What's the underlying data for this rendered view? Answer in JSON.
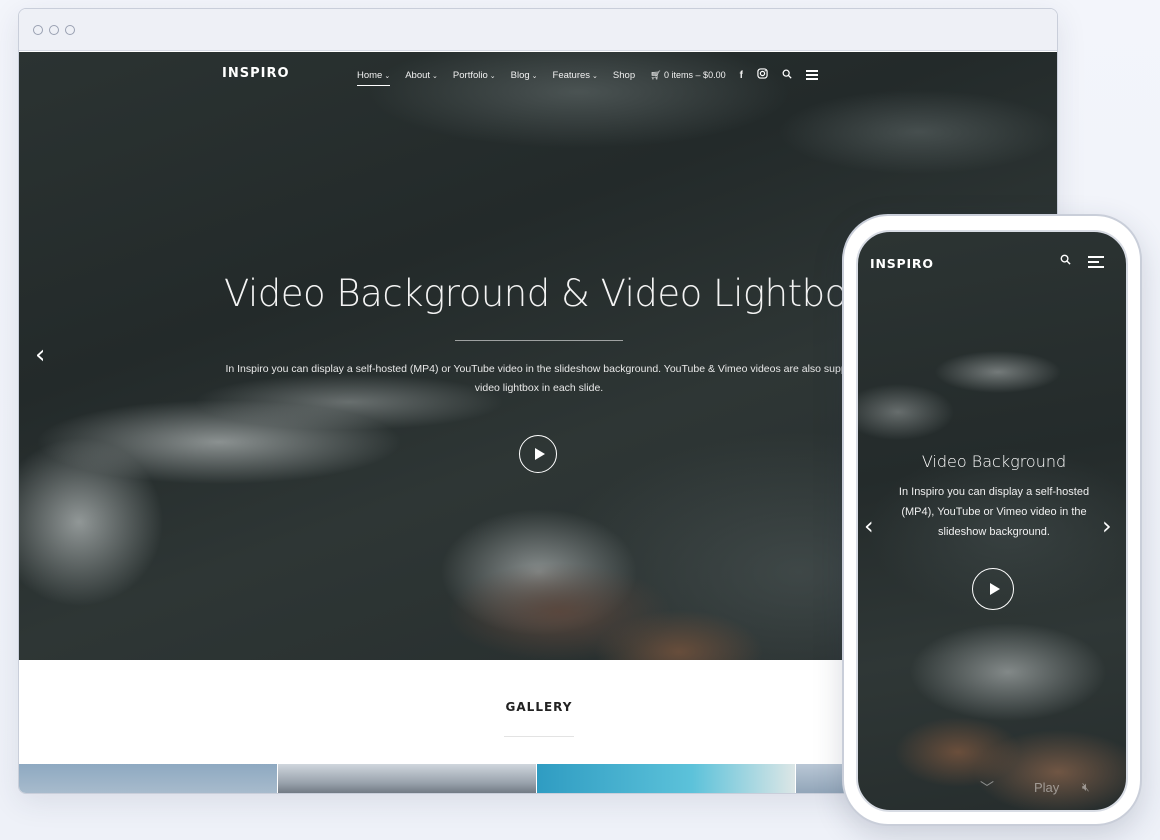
{
  "desktop": {
    "brand": "INSPIRO",
    "menu": [
      {
        "label": "Home",
        "has_dropdown": true,
        "active": true
      },
      {
        "label": "About",
        "has_dropdown": true
      },
      {
        "label": "Portfolio",
        "has_dropdown": true
      },
      {
        "label": "Blog",
        "has_dropdown": true
      },
      {
        "label": "Features",
        "has_dropdown": true
      },
      {
        "label": "Shop",
        "has_dropdown": false
      }
    ],
    "cart_label": "0 items – $0.00",
    "icons": {
      "cart": "cart-icon",
      "facebook": "facebook-icon",
      "instagram": "instagram-icon",
      "search": "search-icon",
      "menu": "hamburger-menu-icon",
      "prev": "chevron-left-icon",
      "play": "play-icon"
    },
    "hero": {
      "title": "Video Background & Video Lightbox",
      "text_line1": "In Inspiro you can display a self-hosted (MP4) or YouTube video in the slideshow background. YouTube & Vimeo videos are also suppo",
      "text_line2": "video lightbox in each slide."
    },
    "gallery_title": "GALLERY"
  },
  "mobile": {
    "brand": "INSPIRO",
    "icons": {
      "search": "search-icon",
      "menu": "hamburger-menu-icon",
      "prev": "chevron-left-icon",
      "next": "chevron-right-icon",
      "play": "play-icon",
      "scroll": "chevron-down-icon",
      "mute": "mute-icon"
    },
    "slide_title": "Video Background",
    "slide_text": "In Inspiro you can display a self-hosted (MP4), YouTube or Vimeo video in the slideshow background.",
    "play_label": "Play"
  },
  "colors": {
    "page_bg": "#f3f5fb",
    "hero_dark": "#262d2d",
    "text_light": "#ffffff"
  }
}
